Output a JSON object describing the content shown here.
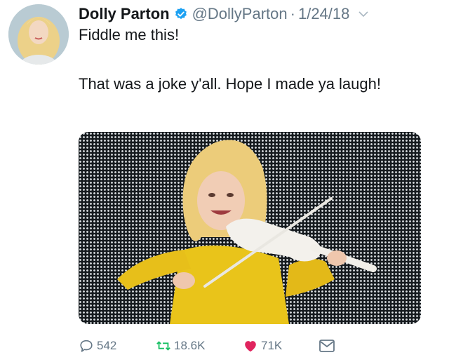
{
  "tweet": {
    "author_name": "Dolly Parton",
    "handle": "@DollyParton",
    "separator": "·",
    "date": "1/24/18",
    "text_line1": "Fiddle me this!",
    "text_line2": "That was a joke y'all. Hope I made ya laugh!"
  },
  "actions": {
    "reply_count": "542",
    "retweet_count": "18.6K",
    "like_count": "71K"
  },
  "icons": {
    "verified": "verified-badge-icon",
    "menu": "chevron-down-icon",
    "reply": "reply-icon",
    "retweet": "retweet-icon",
    "like": "heart-icon",
    "message": "envelope-icon"
  },
  "colors": {
    "verified_blue": "#1da1f2",
    "like_red": "#e0245e",
    "retweet_green": "#17bf63",
    "secondary_text": "#657786",
    "dress_yellow": "#e9c41a"
  }
}
